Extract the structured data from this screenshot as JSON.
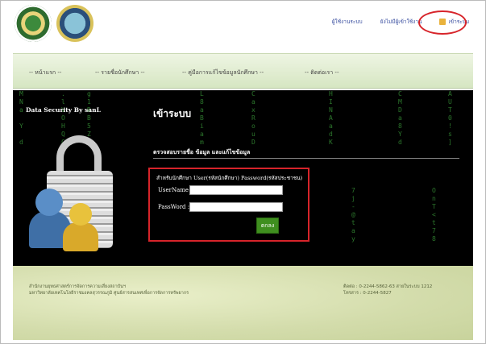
{
  "header": {
    "links": [
      "ผู้ใช้งานระบบ",
      "ยังไม่มีผู้เข้าใช้งาน",
      "เข้าระบบ"
    ]
  },
  "nav": {
    "items": [
      "-- หน้าแรก --",
      "-- รายชื่อนักศึกษา --",
      "-- คู่มือการแก้ไขข้อมูลนักศึกษา --",
      "-- ติดต่อเรา --"
    ]
  },
  "panel": {
    "brand": "Data Security By sanL",
    "title": "เข้าระบบ",
    "subtitle": "ตรวจสอบรายชื่อ ข้อมูล และแก้ไขข้อมูล"
  },
  "login": {
    "hint": "สำหรับนักศึกษา User(รหัสนักศึกษา) Password(รหัสประชาชน)",
    "username_label": "UserName :",
    "password_label": "PassWord :",
    "username_value": "",
    "password_value": "",
    "submit_label": "ตกลง"
  },
  "footer": {
    "left_line1": "สำนักงานยุทธศาสตร์การจัดการความเสี่ยงสถาบันฯ",
    "left_line2": "มหาวิทยาลัยเทคโนโลยีราชมงคลสุวรรณภูมิ ศูนย์สารสนเทศเพื่อการจัดการทรัพยากร",
    "right_line1": "ติดต่อ : 0-2244-5862-63 สายในระบบ 1212",
    "right_line2": "โทรสาร : 0-2244-5827"
  },
  "colors": {
    "accent_red": "#d7242a",
    "matrix_green": "#4fd34f",
    "submit_green": "#3f8f1f"
  }
}
